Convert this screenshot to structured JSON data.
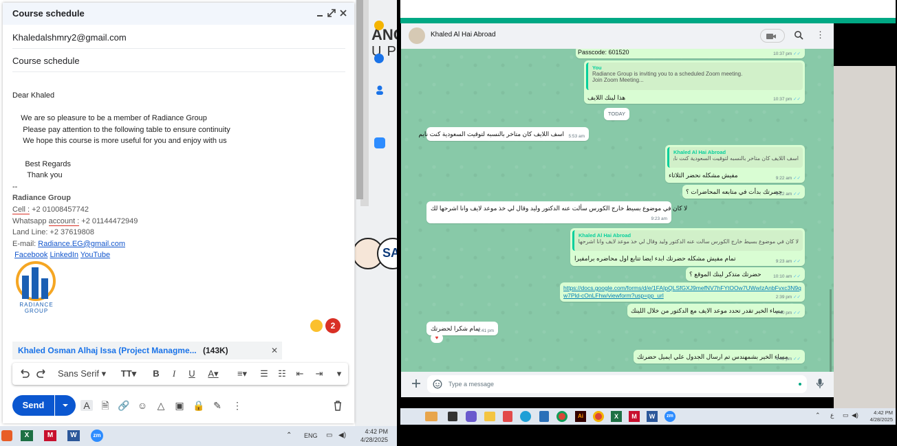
{
  "compose": {
    "title": "Course schedule",
    "to": "Khaledalshmry2@gmail.com",
    "subject": "Course schedule",
    "body_lines": [
      "Dear Khaled",
      "",
      "    We are so pleasure to be a member of Radiance Group",
      "     Please pay attention to the following table to ensure continuity",
      "     We hope this course is more useful for you and enjoy with us",
      "",
      "      Best Regards",
      "       Thank you",
      "--"
    ],
    "signature": {
      "company": "Radiance Group",
      "cell_label": "Cell :",
      "cell_value": " +2 01008457742",
      "whatsapp_label": "Whatsapp ",
      "whatsapp_account": "account :",
      "whatsapp_value": " +2 01144472949",
      "landline": "Land Line: +2 37619808",
      "email_label": "E-mail: ",
      "email": "Radiance.EG@gmail.com",
      "links": [
        "Facebook",
        "LinkedIn",
        "YouTube"
      ],
      "logo_text_1": "RADIANCE",
      "logo_text_2": "GROUP"
    },
    "emoji_count": "2",
    "attachment": {
      "name": "Khaled Osman Alhaj Issa (Project Managme...",
      "size": "(143K)"
    },
    "font_name": "Sans Serif",
    "send_label": "Send"
  },
  "map_strip": {
    "text_1": "ANCE",
    "text_2": "UPE",
    "text_3": "SA"
  },
  "left_taskbar": {
    "language": "ENG",
    "time": "4:42 PM",
    "date": "4/28/2025"
  },
  "whatsapp": {
    "contact": "Khaled Al Hai Abroad",
    "input_placeholder": "Type a message",
    "date_badge": "TODAY",
    "messages": {
      "m0_text": "Passcode: 601520",
      "m0_time": "10:37 pm",
      "m1_quote_name": "You",
      "m1_quote_line1": "Radiance Group is inviting you to a scheduled Zoom meeting.",
      "m1_quote_line2": "Join Zoom Meeting...",
      "m1_text": "هذا لينك اللايف",
      "m1_time": "10:37 pm",
      "m2_text": "اسف اللايف كان متاخر بالنسبه لتوقيت السعودية كنت نايم",
      "m2_time": "5:53 am",
      "m3_quote_name": "Khaled Al Hai Abroad",
      "m3_quote_text": "اسف اللايف كان متاخر بالنسبه لتوقيت السعودية كنت نايم",
      "m3_text": "مفيش مشكله نحضر الثلاثاء",
      "m3_time": "9:22 am",
      "m4_text": "حضرتك بدأت في متابعه المحاضرات ؟",
      "m4_time": "9:22 am",
      "m5_text": "لا كان في موضوع بسيط خارج الكورس سألت عنه الدكتور وليد وقال لي خذ موعد لايف وانا اشرحها لك",
      "m5_time": "9:23 am",
      "m6_quote_name": "Khaled Al Hai Abroad",
      "m6_quote_text": "لا كان في موضوع بسيط خارج الكورس سألت عنه الدكتور وليد وقال لي خذ موعد لايف وانا اشرحها لك",
      "m6_text": "تمام مفيش مشكله حضرتك ابدء ايضا تتابع اول محاضره برامفيرا",
      "m6_time": "9:23 am",
      "m7_text": "حضرتك متذكر لينك الموقع ؟",
      "m7_time": "10:10 am",
      "m8_link1": "https://docs.google.com/forms/d/e/1FAIpQLSfGXJ9mefNV7hFYtOOw7UWwIzAnbFvxc3N9q",
      "m8_link2": "w7Pld-cOnLFhw/viewform?usp=pp_url",
      "m8_time": "2:39 pm",
      "m9_text": "مساء الخير تقدر تحدد موعد الايف مع الدكتور من خلال اللينك",
      "m9_time": "2:40 pm",
      "m10_text": "تمام شكرا لحضرتك",
      "m10_time": "2:41 pm",
      "m11_text": "مساء الخير بشمهندس تم ارسال الجدول علي ايميل حضرتك",
      "m11_time": "4:42 pm"
    }
  },
  "right_taskbar": {
    "time": "4:42 PM",
    "date": "4/28/2025",
    "lang": "ع"
  },
  "colors": {
    "wa_green": "#00a884",
    "send_blue": "#0b57d0",
    "out_bubble": "#d9fdd3"
  },
  "icons": [
    "minimize-icon",
    "fullscreen-icon",
    "close-icon",
    "undo-icon",
    "redo-icon",
    "bold-icon",
    "italic-icon",
    "underline-icon",
    "trash-icon",
    "search-icon",
    "menu-icon",
    "mic-icon",
    "plus-icon",
    "emoji-icon"
  ]
}
